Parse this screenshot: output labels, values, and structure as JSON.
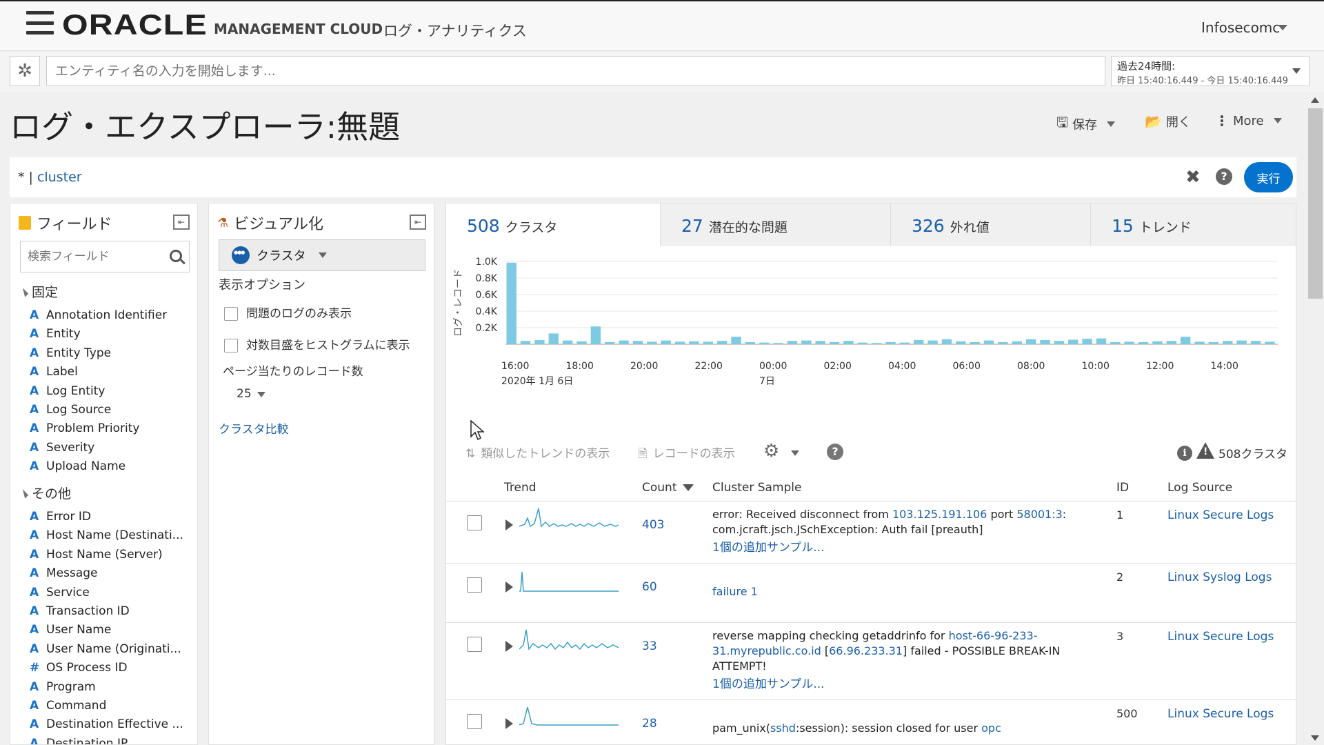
{
  "header": {
    "logo": "ORACLE",
    "product": "MANAGEMENT CLOUD",
    "app": "ログ・アナリティクス",
    "tenant": "Infosecomc"
  },
  "entity_bar": {
    "placeholder": "エンティティ名の入力を開始します...",
    "time_label": "過去24時間:",
    "time_value": "昨日 15:40:16.449 - 今日 15:40:16.449"
  },
  "page": {
    "title": "ログ・エクスプローラ:無題",
    "save_label": "保存",
    "open_label": "開く",
    "more_label": "More"
  },
  "query": {
    "prefix": "* | ",
    "command": "cluster",
    "run_label": "実行"
  },
  "fields": {
    "title": "フィールド",
    "search_placeholder": "検索フィールド",
    "fixed_label": "固定",
    "fixed": [
      {
        "type": "A",
        "name": "Annotation Identifier"
      },
      {
        "type": "A",
        "name": "Entity"
      },
      {
        "type": "A",
        "name": "Entity Type"
      },
      {
        "type": "A",
        "name": "Label"
      },
      {
        "type": "A",
        "name": "Log Entity"
      },
      {
        "type": "A",
        "name": "Log Source"
      },
      {
        "type": "A",
        "name": "Problem Priority"
      },
      {
        "type": "A",
        "name": "Severity"
      },
      {
        "type": "A",
        "name": "Upload Name"
      }
    ],
    "other_label": "その他",
    "other": [
      {
        "type": "A",
        "name": "Error ID"
      },
      {
        "type": "A",
        "name": "Host Name (Destinati..."
      },
      {
        "type": "A",
        "name": "Host Name (Server)"
      },
      {
        "type": "A",
        "name": "Message"
      },
      {
        "type": "A",
        "name": "Service"
      },
      {
        "type": "A",
        "name": "Transaction ID"
      },
      {
        "type": "A",
        "name": "User Name"
      },
      {
        "type": "A",
        "name": "User Name (Originati..."
      },
      {
        "type": "#",
        "name": "OS Process ID"
      },
      {
        "type": "A",
        "name": "Program"
      },
      {
        "type": "A",
        "name": "Command"
      },
      {
        "type": "A",
        "name": "Destination Effective ..."
      },
      {
        "type": "A",
        "name": "Destination IP"
      }
    ]
  },
  "visualize": {
    "title": "ビジュアル化",
    "selected": "クラスタ",
    "options_label": "表示オプション",
    "opt_problem_only": "問題のログのみ表示",
    "opt_log_scale": "対数目盛をヒストグラムに表示",
    "records_label": "ページ当たりのレコード数",
    "records_value": "25",
    "compare_link": "クラスタ比較"
  },
  "summary": {
    "tabs": [
      {
        "count": "508",
        "label": "クラスタ"
      },
      {
        "count": "27",
        "label": "潜在的な問題"
      },
      {
        "count": "326",
        "label": "外れ値"
      },
      {
        "count": "15",
        "label": "トレンド"
      }
    ]
  },
  "chart_data": {
    "type": "bar",
    "ylabel": "ログ・レコード",
    "ylim": [
      0,
      1000
    ],
    "y_ticks": [
      "1.0K",
      "0.8K",
      "0.6K",
      "0.4K",
      "0.2K"
    ],
    "x_ticks": [
      {
        "label": "16:00",
        "sub": "2020年 1月 6日"
      },
      {
        "label": "18:00",
        "sub": ""
      },
      {
        "label": "20:00",
        "sub": ""
      },
      {
        "label": "22:00",
        "sub": ""
      },
      {
        "label": "00:00",
        "sub": "7日"
      },
      {
        "label": "02:00",
        "sub": ""
      },
      {
        "label": "04:00",
        "sub": ""
      },
      {
        "label": "06:00",
        "sub": ""
      },
      {
        "label": "08:00",
        "sub": ""
      },
      {
        "label": "10:00",
        "sub": ""
      },
      {
        "label": "12:00",
        "sub": ""
      },
      {
        "label": "14:00",
        "sub": ""
      }
    ],
    "values": [
      985,
      40,
      50,
      130,
      45,
      35,
      215,
      25,
      45,
      40,
      30,
      45,
      30,
      35,
      30,
      40,
      90,
      25,
      20,
      15,
      40,
      45,
      40,
      25,
      40,
      20,
      15,
      25,
      20,
      50,
      45,
      60,
      35,
      25,
      45,
      25,
      35,
      60,
      50,
      40,
      55,
      65,
      70,
      25,
      30,
      25,
      35,
      40,
      90,
      30,
      25,
      40,
      45,
      40,
      30
    ]
  },
  "toolbar": {
    "similar_trends": "類似したトレンドの表示",
    "show_records": "レコードの表示",
    "cluster_count": "508クラスタ"
  },
  "table": {
    "headers": {
      "trend": "Trend",
      "count": "Count",
      "sample": "Cluster Sample",
      "id": "ID",
      "source": "Log Source"
    },
    "rows": [
      {
        "count": "403",
        "sample_pre": "error: Received disconnect from ",
        "sample_link1": "103.125.191.106",
        "sample_mid": " port ",
        "sample_link2": "58001:3",
        "sample_post": ": com.jcraft.jsch.JSchException: Auth fail [preauth]",
        "more": "1個の追加サンプル...",
        "id": "1",
        "source": "Linux Secure Logs"
      },
      {
        "count": "60",
        "sample_link": "failure 1",
        "id": "2",
        "source": "Linux Syslog Logs"
      },
      {
        "count": "33",
        "sample_pre": "reverse mapping checking getaddrinfo for ",
        "sample_link1": "host-66-96-233-31.myrepublic.co.id",
        "sample_mid": " [",
        "sample_link2": "66.96.233.31",
        "sample_post": "] failed - POSSIBLE BREAK-IN ATTEMPT!",
        "more": "1個の追加サンプル...",
        "id": "3",
        "source": "Linux Secure Logs"
      },
      {
        "count": "28",
        "sample_pre": "pam_unix(",
        "sample_link1": "sshd",
        "sample_mid": ":session): session closed for user ",
        "sample_link2": "opc",
        "sample_post": "",
        "id": "500",
        "source": "Linux Secure Logs"
      }
    ]
  }
}
